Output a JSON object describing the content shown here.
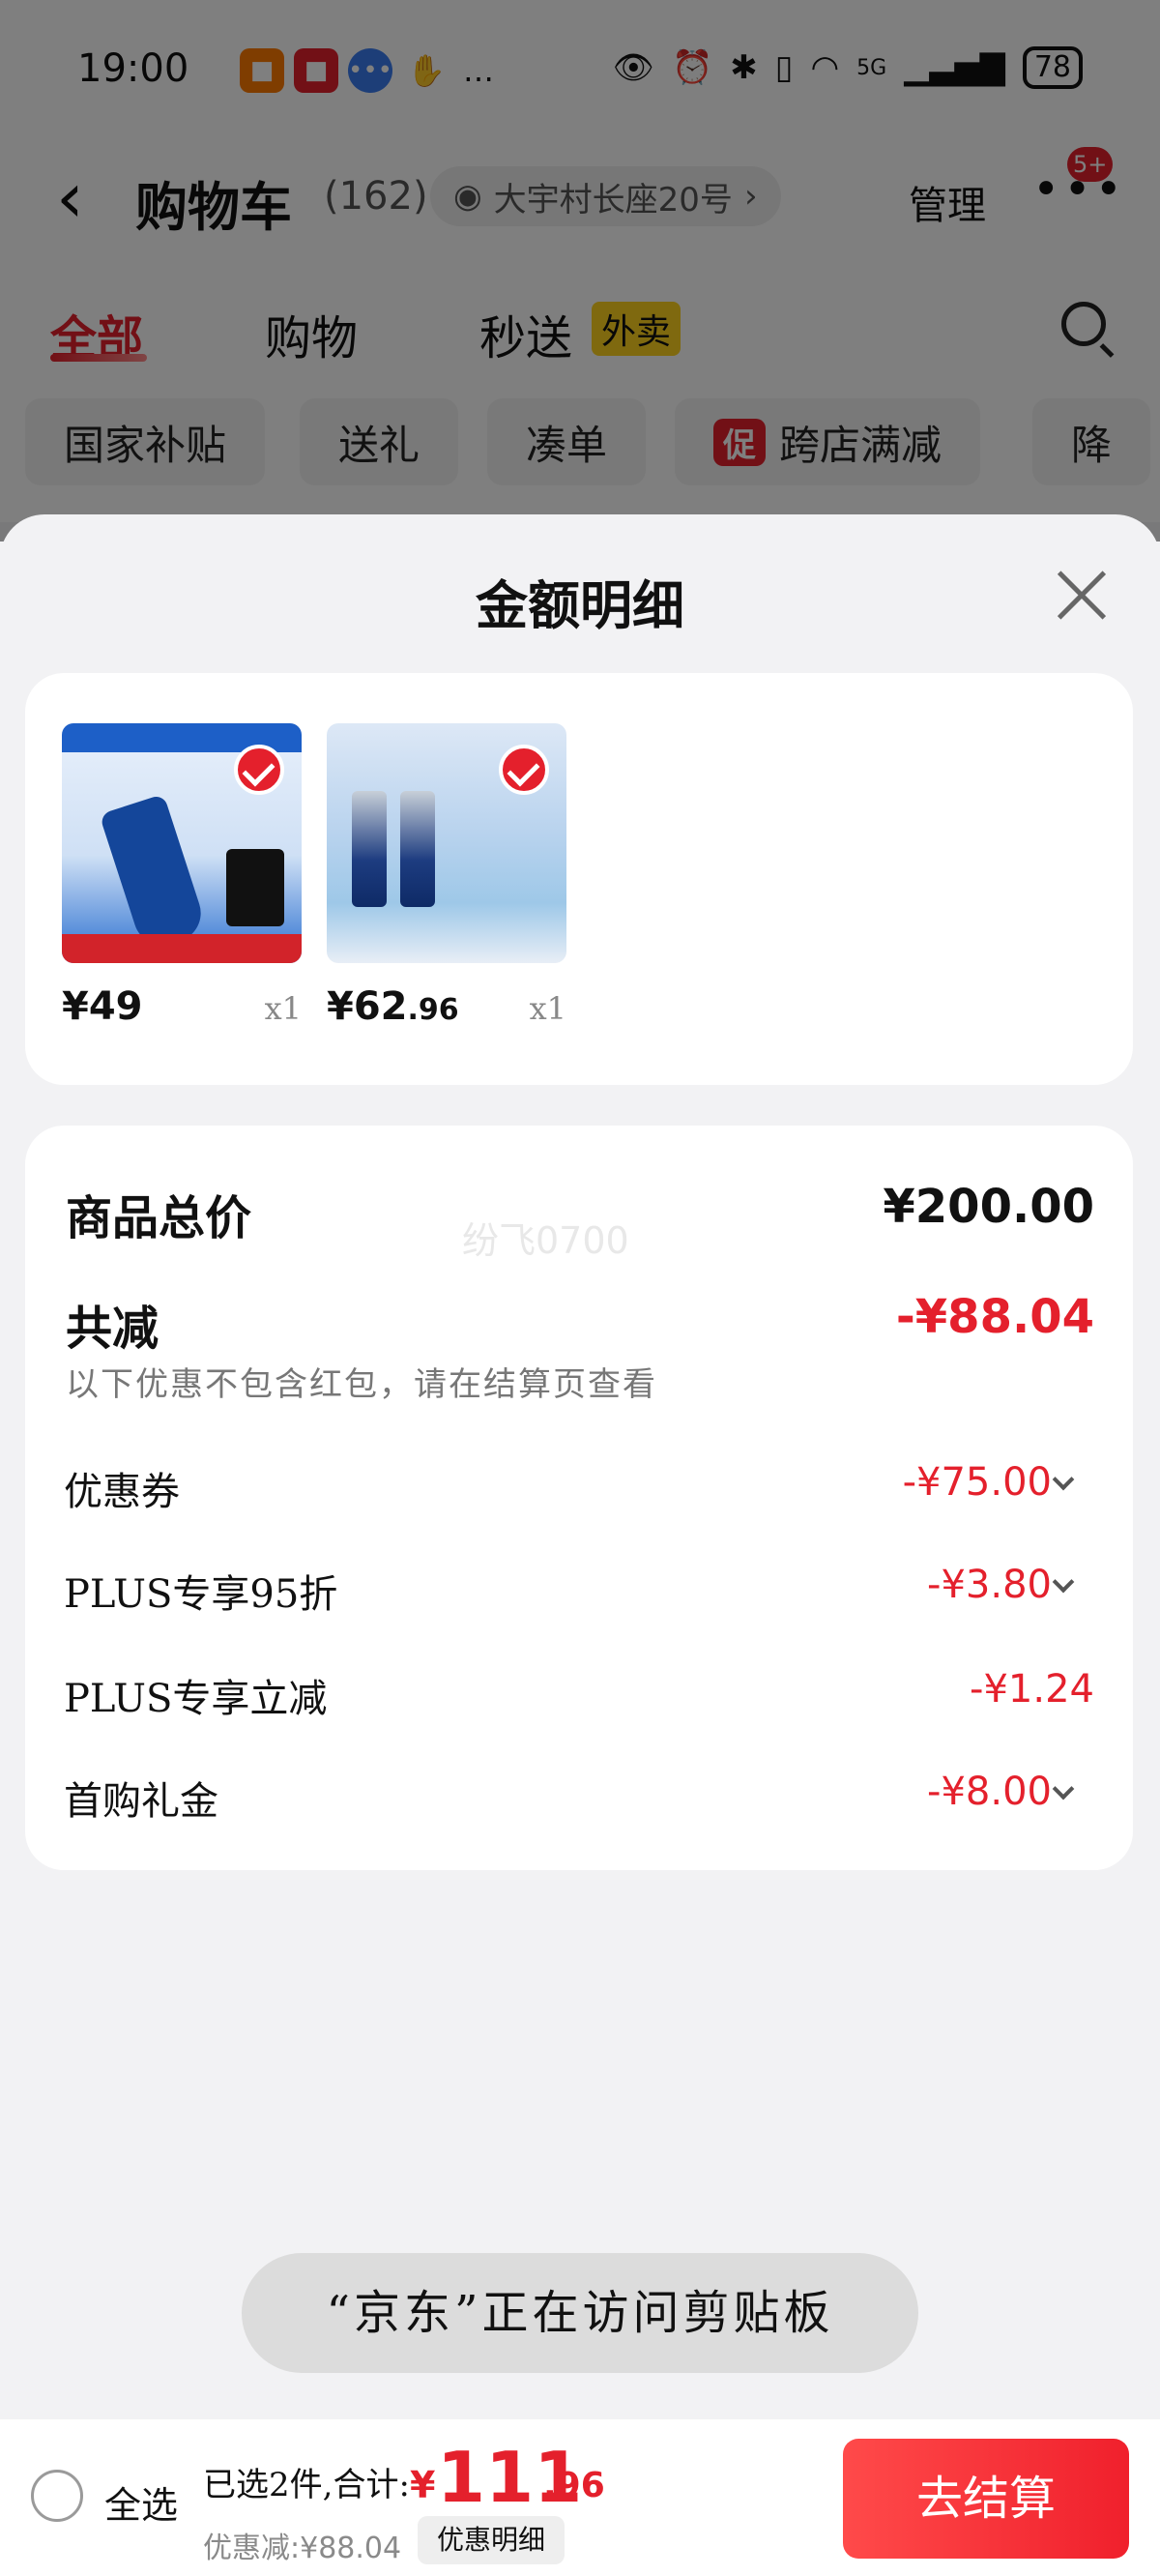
{
  "status": {
    "time": "19:00",
    "signal": "5G",
    "battery": "78"
  },
  "nav": {
    "title": "购物车",
    "count": "(162)",
    "address": "大宇村长座20号",
    "manage": "管理",
    "more_badge": "5+"
  },
  "tabs": [
    {
      "label": "全部"
    },
    {
      "label": "购物"
    },
    {
      "label": "秒送"
    }
  ],
  "tab_tag": "外卖",
  "chips": [
    {
      "label": "国家补贴"
    },
    {
      "label": "送礼"
    },
    {
      "label": "凑单"
    },
    {
      "label": "跨店满减",
      "tag": "促"
    },
    {
      "label": "降"
    }
  ],
  "sheet": {
    "title": "金额明细",
    "products": [
      {
        "price_int": "¥49",
        "price_dec": "",
        "qty": "x1"
      },
      {
        "price_int": "¥62",
        "price_dec": ".96",
        "qty": "x1"
      }
    ],
    "total_label": "商品总价",
    "total_value": "¥200.00",
    "watermark": "纷飞0700",
    "reduce_label": "共减",
    "reduce_value": "-¥88.04",
    "note": "以下优惠不包含红包，请在结算页查看",
    "items": [
      {
        "label": "优惠券",
        "value": "-¥75.00",
        "expandable": true
      },
      {
        "label": "PLUS专享95折",
        "value": "-¥3.80",
        "expandable": true
      },
      {
        "label": "PLUS专享立减",
        "value": "-¥1.24",
        "expandable": false
      },
      {
        "label": "首购礼金",
        "value": "-¥8.00",
        "expandable": true
      }
    ]
  },
  "toast": "“京东”正在访问剪贴板",
  "bottom": {
    "select_all": "全选",
    "summary": "已选2件,合计:",
    "currency": "¥",
    "total_int": "111",
    "total_dec": ".96",
    "discount": "优惠减:¥88.04",
    "detail_btn": "优惠明细",
    "checkout": "去结算"
  }
}
